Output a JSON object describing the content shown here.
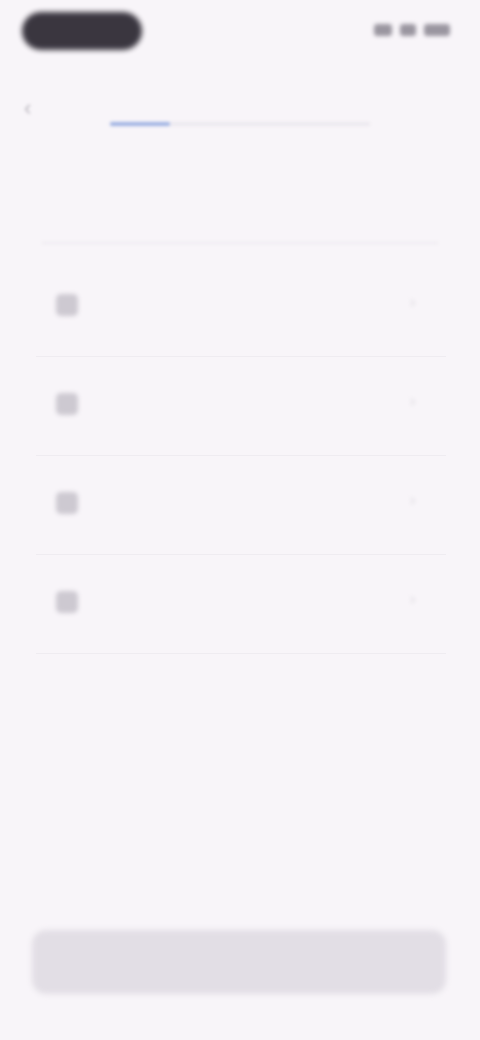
{
  "status_bar": {
    "time": "",
    "icons": [
      "signal-icon",
      "wifi-icon",
      "battery-icon"
    ]
  },
  "header": {
    "back_icon": "arrow-left-icon",
    "title": "",
    "progress": 0.23
  },
  "question": {
    "text": ""
  },
  "options": [
    {
      "icon": "option-icon",
      "label": ""
    },
    {
      "icon": "option-icon",
      "label": ""
    },
    {
      "icon": "option-icon",
      "label": ""
    },
    {
      "icon": "option-icon",
      "label": ""
    }
  ],
  "footer": {
    "button_label": ""
  },
  "colors": {
    "background": "#f8f5f9",
    "accent": "#9fb2e2",
    "button": "#e2dee5"
  }
}
